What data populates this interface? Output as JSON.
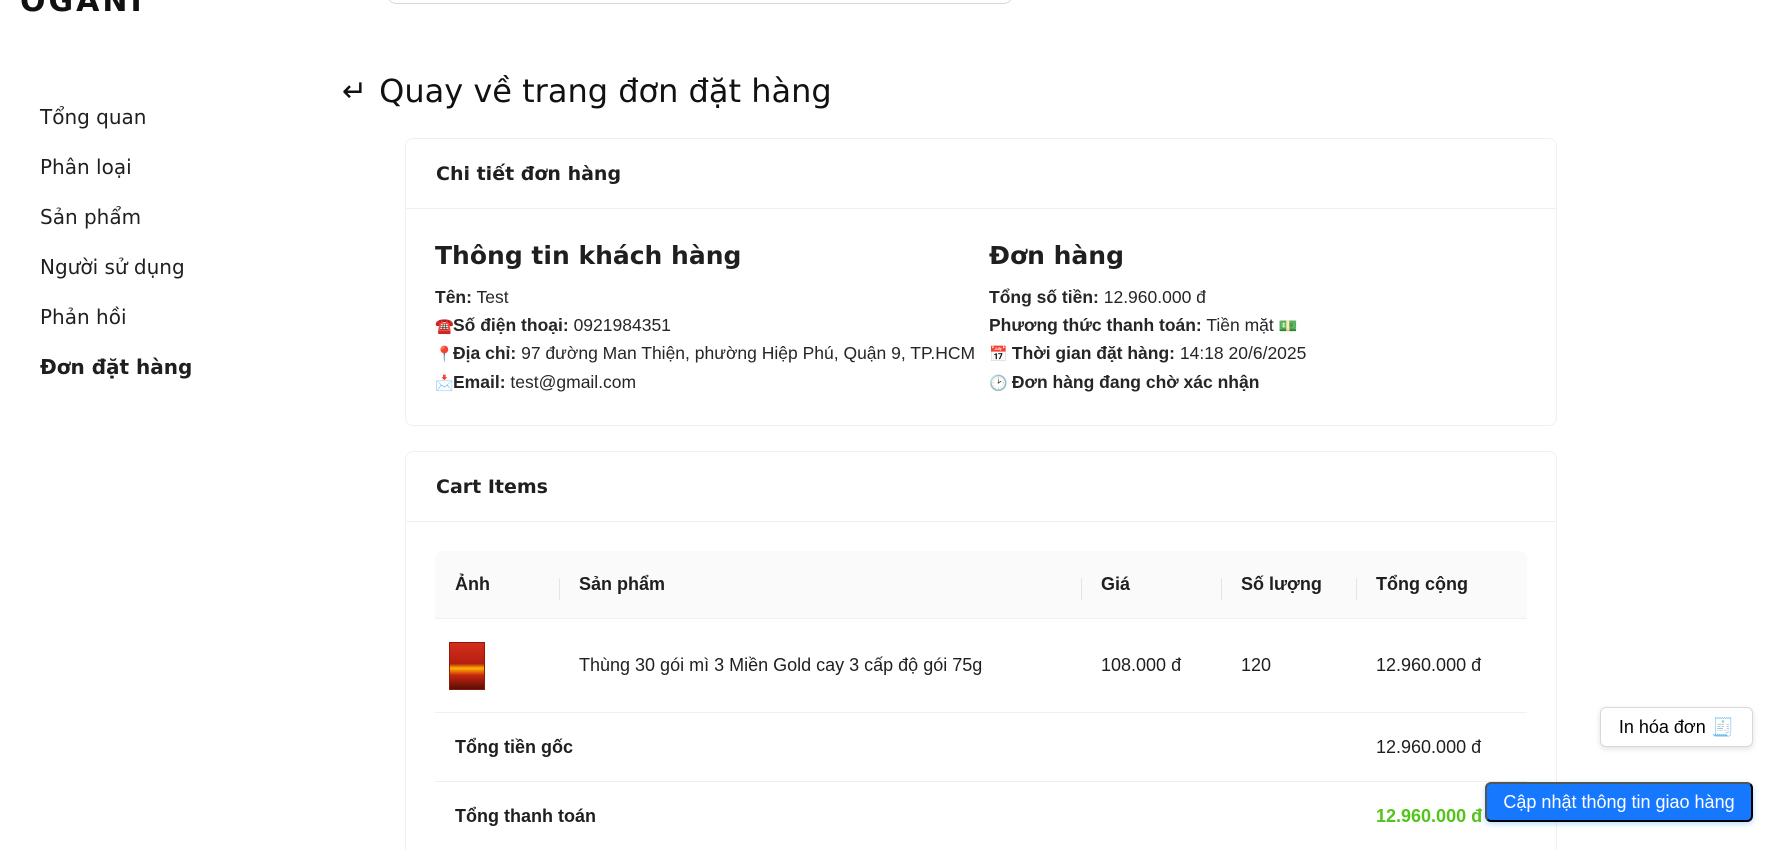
{
  "topbar": {
    "logo": "OGANI"
  },
  "sidebar": {
    "items": [
      {
        "label": "Tổng quan"
      },
      {
        "label": "Phân loại"
      },
      {
        "label": "Sản phẩm"
      },
      {
        "label": "Người sử dụng"
      },
      {
        "label": "Phản hồi"
      },
      {
        "label": "Đơn đặt hàng",
        "active": true
      }
    ]
  },
  "back": {
    "arrow": "↵",
    "label": "Quay về trang đơn đặt hàng"
  },
  "order_card": {
    "title": "Chi tiết đơn hàng",
    "customer": {
      "heading": "Thông tin khách hàng",
      "name_label": "Tên:",
      "name": "Test",
      "phone_icon": "☎️",
      "phone_label": "Số điện thoại:",
      "phone": "0921984351",
      "address_icon": "📍",
      "address_label": "Địa chỉ:",
      "address": "97 đường Man Thiện, phường Hiệp Phú, Quận 9, TP.HCM",
      "email_icon": "📩",
      "email_label": "Email:",
      "email": "test@gmail.com"
    },
    "order": {
      "heading": "Đơn hàng",
      "total_label": "Tổng số tiền:",
      "total": "12.960.000 đ",
      "payment_label": "Phương thức thanh toán:",
      "payment": "Tiền mặt",
      "payment_icon": "💵",
      "time_icon": "📅",
      "time_label": "Thời gian đặt hàng:",
      "time": "14:18 20/6/2025",
      "status_icon": "🕑",
      "status": "Đơn hàng đang chờ xác nhận"
    }
  },
  "cart_card": {
    "title": "Cart Items",
    "columns": [
      "Ảnh",
      "Sản phẩm",
      "Giá",
      "Số lượng",
      "Tổng cộng"
    ],
    "rows": [
      {
        "product": "Thùng 30 gói mì 3 Miền Gold cay 3 cấp độ gói 75g",
        "price": "108.000 đ",
        "quantity": "120",
        "total": "12.960.000 đ"
      }
    ],
    "subtotal_label": "Tổng tiền gốc",
    "subtotal": "12.960.000 đ",
    "grand_total_label": "Tổng thanh toán",
    "grand_total": "12.960.000 đ"
  },
  "actions": {
    "print_label": "In hóa đơn",
    "print_icon": "🧾",
    "update_label": "Cập nhật thông tin giao hàng"
  },
  "colors": {
    "primary": "#1677ff",
    "success": "#52c41a"
  }
}
